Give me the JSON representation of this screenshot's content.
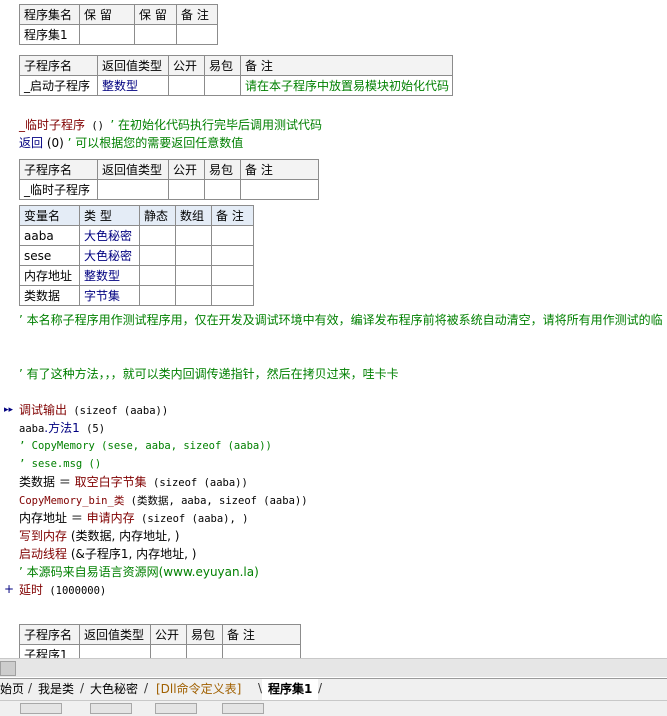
{
  "assembly_table": {
    "headers": [
      "程序集名",
      "保 留",
      "保 留",
      "备 注"
    ],
    "row": [
      "程序集1",
      "",
      "",
      ""
    ]
  },
  "startup_table": {
    "headers": [
      "子程序名",
      "返回值类型",
      "公开",
      "易包",
      "备 注"
    ],
    "row": [
      "_启动子程序",
      "整数型",
      "",
      "",
      "请在本子程序中放置易模块初始化代码"
    ]
  },
  "temp_code": {
    "line1_name": "_临时子程序",
    "line1_parens": " () ",
    "line1_comment": "’ 在初始化代码执行完毕后调用测试代码",
    "line2_kw": "返回",
    "line2_args": " (0) ",
    "line2_comment": "’ 可以根据您的需要返回任意数值"
  },
  "temp_table": {
    "headers": [
      "子程序名",
      "返回值类型",
      "公开",
      "易包",
      "备 注"
    ],
    "row": [
      "_临时子程序",
      "",
      "",
      "",
      ""
    ]
  },
  "var_table": {
    "headers": [
      "变量名",
      "类 型",
      "静态",
      "数组",
      "备 注"
    ],
    "rows": [
      [
        "aaba",
        "大色秘密",
        "",
        "",
        ""
      ],
      [
        "sese",
        "大色秘密",
        "",
        "",
        ""
      ],
      [
        "内存地址",
        "整数型",
        "",
        "",
        ""
      ],
      [
        "类数据",
        "字节集",
        "",
        "",
        ""
      ]
    ]
  },
  "comments": {
    "c1": "’ 本名称子程序用作测试程序用，仅在开发及调试环境中有效，编译发布程序前将被系统自动清空，请将所有用作测试的临",
    "c2": "’ 有了这种方法，，，就可以类内回调传递指针，然后在拷贝过来，哇卡卡"
  },
  "code": {
    "l1_kw": "调试输出",
    "l1_rest": " (sizeof (aaba))",
    "l2_obj": "aaba",
    "l2_method": ".方法1",
    "l2_rest": " (5)",
    "l3": "’ CopyMemory (sese, aaba, sizeof (aaba))",
    "l4": "’ sese.msg ()",
    "l5_var": "类数据",
    "l5_eq": " ＝ ",
    "l5_fn": "取空白字节集",
    "l5_rest": " (sizeof (aaba))",
    "l6_fn": "CopyMemory_bin_类",
    "l6_rest": " (类数据, aaba, sizeof (aaba))",
    "l7_var": "内存地址",
    "l7_eq": " ＝ ",
    "l7_fn": "申请内存",
    "l7_rest": " (sizeof (aaba), )",
    "l8_fn": "写到内存",
    "l8_rest": " (类数据, 内存地址, )",
    "l9_fn": "启动线程",
    "l9_rest": " (&子程序1, 内存地址, )",
    "l10": "’ 本源码来自易语言资源网(www.eyuyan.la)",
    "l11_fn": "延时",
    "l11_rest": " (1000000)"
  },
  "sub1_table": {
    "headers": [
      "子程序名",
      "返回值类型",
      "公开",
      "易包",
      "备 注"
    ],
    "row": [
      "子程序1",
      "",
      "",
      "",
      ""
    ]
  },
  "tabs": [
    "始页",
    "我是类",
    "大色秘密",
    "[Dll命令定义表]",
    "程序集1"
  ]
}
